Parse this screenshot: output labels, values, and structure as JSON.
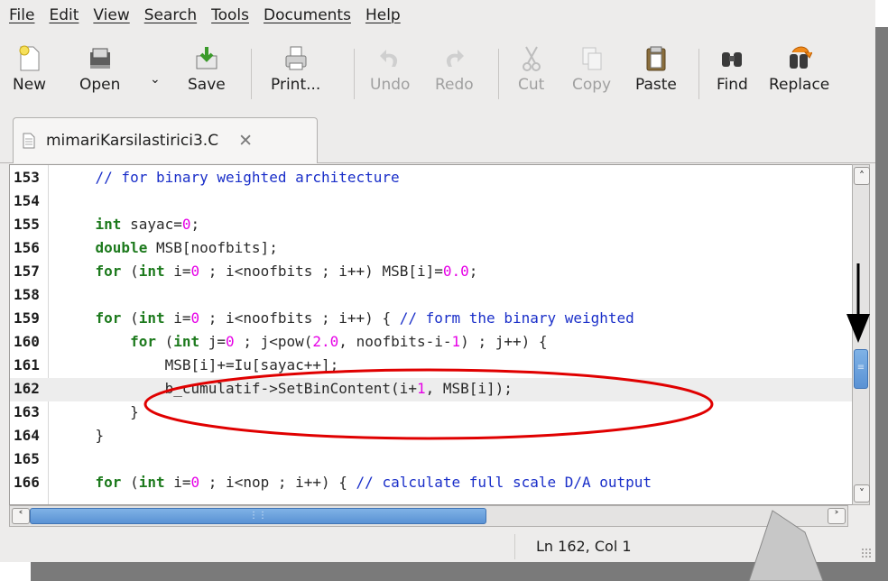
{
  "menubar": {
    "items": [
      "File",
      "Edit",
      "View",
      "Search",
      "Tools",
      "Documents",
      "Help"
    ]
  },
  "toolbar": {
    "new": "New",
    "open": "Open",
    "save": "Save",
    "print": "Print...",
    "undo": "Undo",
    "redo": "Redo",
    "cut": "Cut",
    "copy": "Copy",
    "paste": "Paste",
    "find": "Find",
    "replace": "Replace"
  },
  "tab": {
    "filename": "mimariKarsilastirici3.C",
    "close": "✕"
  },
  "editor": {
    "current_line": "162",
    "lines": [
      {
        "n": "153",
        "code": "    // for binary weighted architecture"
      },
      {
        "n": "154",
        "code": ""
      },
      {
        "n": "155",
        "code": "    int sayac=0;"
      },
      {
        "n": "156",
        "code": "    double MSB[noofbits];"
      },
      {
        "n": "157",
        "code": "    for (int i=0 ; i<noofbits ; i++) MSB[i]=0.0;"
      },
      {
        "n": "158",
        "code": ""
      },
      {
        "n": "159",
        "code": "    for (int i=0 ; i<noofbits ; i++) { // form the binary weighted"
      },
      {
        "n": "160",
        "code": "        for (int j=0 ; j<pow(2.0, noofbits-i-1) ; j++) {"
      },
      {
        "n": "161",
        "code": "            MSB[i]+=Iu[sayac++];"
      },
      {
        "n": "162",
        "code": "            b_cumulatif->SetBinContent(i+1, MSB[i]);"
      },
      {
        "n": "163",
        "code": "        }"
      },
      {
        "n": "164",
        "code": "    }"
      },
      {
        "n": "165",
        "code": ""
      },
      {
        "n": "166",
        "code": "    for (int i=0 ; i<nop ; i++) { // calculate full scale D/A output"
      }
    ]
  },
  "statusbar": {
    "position": "Ln 162, Col 1"
  },
  "colors": {
    "keyword": "#1d7a1d",
    "comment": "#1a2fc9",
    "number": "#e600e6",
    "annotation_ellipse": "#e00000"
  }
}
